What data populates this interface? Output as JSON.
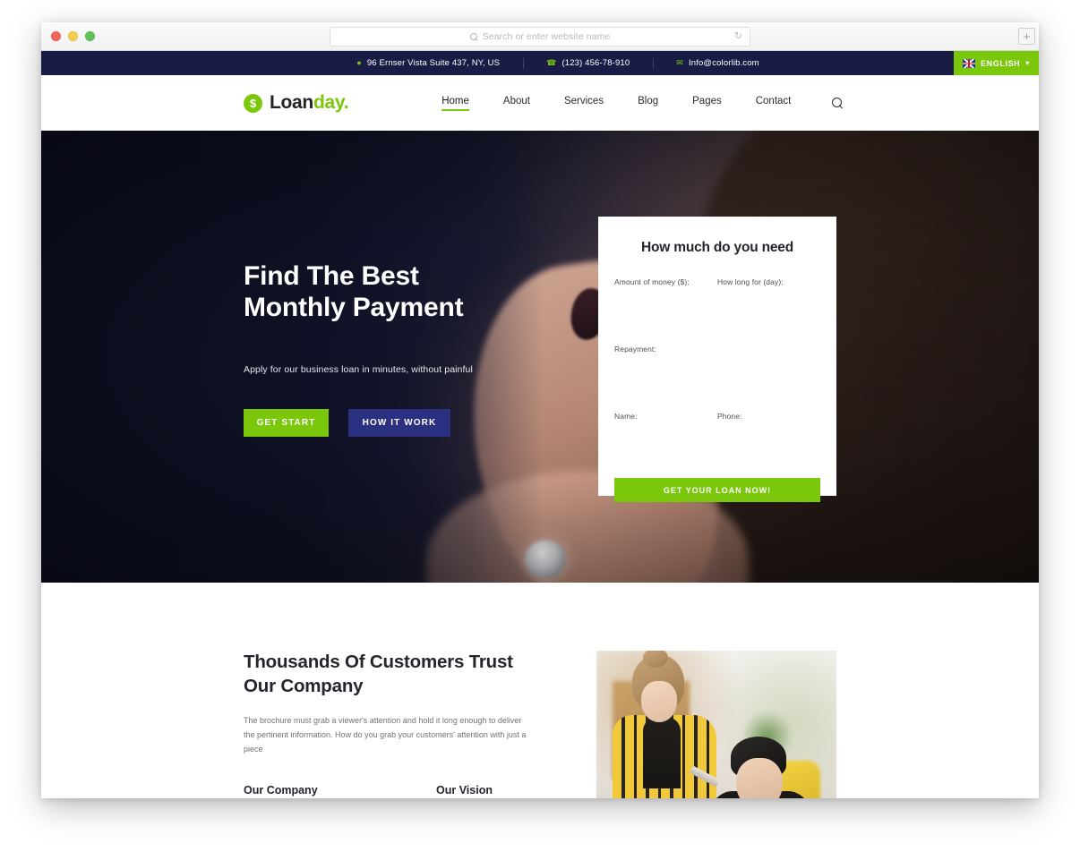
{
  "browser": {
    "omnibox_placeholder": "Search or enter website name",
    "reload_icon": "reload-icon",
    "newtab_label": "+",
    "traffic_lights": [
      "close",
      "minimize",
      "maximize"
    ]
  },
  "topbar": {
    "address": "96 Ernser Vista Suite 437, NY, US",
    "phone": "(123) 456-78-910",
    "email": "Info@colorlib.com",
    "address_icon": "location-pin-icon",
    "phone_icon": "phone-icon",
    "email_icon": "envelope-icon",
    "language": "ENGLISH",
    "language_caret": "⌄",
    "bg_color": "#191C45",
    "accent_color": "#7AC70C"
  },
  "nav": {
    "logo": {
      "coin": "$",
      "text_dark": "Loan",
      "text_green": "day."
    },
    "links": [
      {
        "label": "Home",
        "active": true
      },
      {
        "label": "About",
        "active": false
      },
      {
        "label": "Services",
        "active": false
      },
      {
        "label": "Blog",
        "active": false
      },
      {
        "label": "Pages",
        "active": false
      },
      {
        "label": "Contact",
        "active": false
      }
    ],
    "search_icon": "search-icon"
  },
  "hero": {
    "title_line1": "Find The Best",
    "title_line2": "Monthly Payment",
    "subtitle": "Apply for our business loan in minutes, without painful",
    "primary_button": "GET START",
    "secondary_button": "HOW IT WORK",
    "primary_color": "#7AC70C",
    "secondary_color": "#2B3180"
  },
  "loan_form": {
    "title": "How much do you need",
    "fields": [
      {
        "label": "Amount of money ($):",
        "value": ""
      },
      {
        "label": "How long for (day):",
        "value": ""
      },
      {
        "label": "Repayment:",
        "value": ""
      },
      {
        "label": "Name:",
        "value": ""
      },
      {
        "label": "Phone:",
        "value": ""
      }
    ],
    "submit_label": "GET YOUR LOAN NOW!",
    "submit_color": "#7AC70C"
  },
  "trust": {
    "title_line1": "Thousands Of Customers Trust",
    "title_line2": "Our Company",
    "paragraph": "The brochure must grab a viewer's attention and hold it long enough to deliver the pertinent information. How do you grab your customers' attention with just a piece",
    "columns": [
      {
        "heading": "Our Company",
        "text": ""
      },
      {
        "heading": "Our Vision",
        "text": ""
      }
    ]
  }
}
